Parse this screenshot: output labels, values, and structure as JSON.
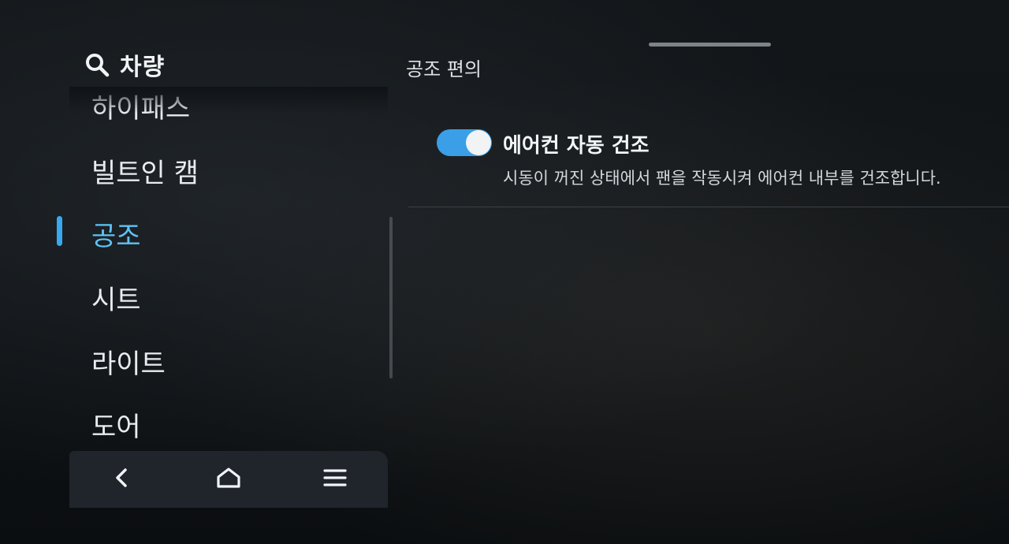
{
  "sidebar": {
    "category_title": "차량",
    "items": [
      {
        "label": "하이패스"
      },
      {
        "label": "빌트인 캠"
      },
      {
        "label": "공조"
      },
      {
        "label": "시트"
      },
      {
        "label": "라이트"
      },
      {
        "label": "도어"
      }
    ],
    "active_item": "공조"
  },
  "bottom_nav": {
    "buttons": [
      "back-icon",
      "home-icon",
      "menu-icon"
    ]
  },
  "content": {
    "section_title": "공조 편의",
    "settings": [
      {
        "label": "에어컨 자동 건조",
        "description": "시동이 꺼진 상태에서 팬을 작동시켜 에어컨 내부를 건조합니다.",
        "enabled": true
      }
    ]
  },
  "colors": {
    "accent": "#39a8ec",
    "active_text": "#5fc3f5",
    "background": "#0f1316"
  }
}
